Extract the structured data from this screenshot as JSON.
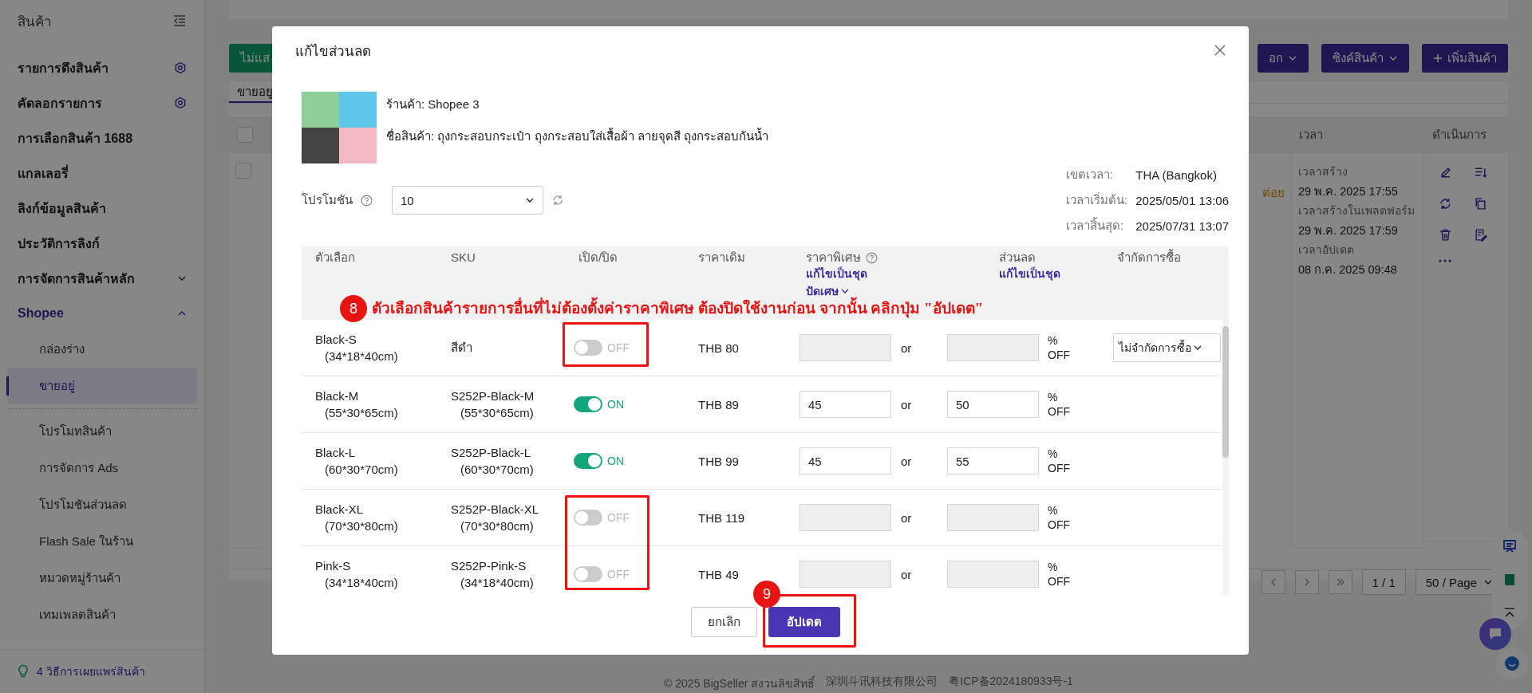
{
  "sidebar": {
    "title": "สินค้า",
    "items": [
      {
        "label": "รายการดึงสินค้า",
        "kind": "setting",
        "selected": false
      },
      {
        "label": "คัดลอกรายการ",
        "kind": "setting",
        "selected": false
      },
      {
        "label": "การเลือกสินค้า 1688",
        "kind": "plain",
        "selected": false
      },
      {
        "label": "แกลเลอรี่",
        "kind": "plain",
        "selected": false
      },
      {
        "label": "ลิงก์ข้อมูลสินค้า",
        "kind": "plain",
        "selected": false
      },
      {
        "label": "ประวัติการลิงก์",
        "kind": "plain",
        "selected": false
      },
      {
        "label": "การจัดการสินค้าหลัก",
        "kind": "group",
        "expanded": false,
        "selected": false
      },
      {
        "label": "Shopee",
        "kind": "group",
        "expanded": true,
        "selected": true,
        "sections": [
          {
            "items": [
              {
                "label": "กล่องร่าง",
                "selected": false
              },
              {
                "label": "ขายอยู่",
                "selected": true
              }
            ]
          },
          {
            "items": [
              {
                "label": "โปรโมทสินค้า",
                "selected": false
              },
              {
                "label": "การจัดการ Ads",
                "selected": false
              },
              {
                "label": "โปรโมชันส่วนลด",
                "selected": false
              },
              {
                "label": "Flash Sale ในร้าน",
                "selected": false
              },
              {
                "label": "หมวดหมู่ร้านค้า",
                "selected": false
              },
              {
                "label": "เทมเพลตสินค้า",
                "selected": false
              }
            ]
          }
        ]
      }
    ],
    "tip": "4 วิธีการเผยแพร่สินค้า"
  },
  "toolbar": {
    "left_button": "ไม่แส",
    "right_buttons": [
      {
        "label": "อก",
        "kind": "dropdown"
      },
      {
        "label": "ซิงค์สินค้า",
        "kind": "dropdown"
      },
      {
        "label": "เพิ่มสินค้า",
        "kind": "add"
      }
    ]
  },
  "tabs": [
    {
      "label": "ขายอยู",
      "selected": true
    }
  ],
  "table": {
    "select_all_checked": false,
    "columns": [
      "เวลา",
      "ดำเนินการ"
    ],
    "rows": [
      {
        "checked": false,
        "status_fragment": "ต่อย",
        "times": [
          {
            "label": "เวลาสร้าง",
            "value": "29 พ.ค. 2025 17:55"
          },
          {
            "label": "เวลาสร้างในเพลตฟอร์ม",
            "value": "29 พ.ค. 2025 17:59"
          },
          {
            "label": "เวลาอัปเดต",
            "value": "08 ก.ค. 2025 09:48"
          }
        ]
      }
    ]
  },
  "pagination": {
    "page": "1 / 1",
    "page_size": "50 / Page"
  },
  "footer": [
    "© 2025 BigSeller สงวนลิขสิทธิ์",
    "深圳斗讯科技有限公司",
    "粤ICP备2024180933号-1"
  ],
  "dialog": {
    "title": "แก้ไขส่วนลด",
    "store_label": "ร้านค้า:",
    "store": "Shopee 3",
    "product_label": "ชื่อสินค้า:",
    "product": "ถุงกระสอบกระเป๋า ถุงกระสอบใส่เสื้อผ้า ลายจุดสี ถุงกระสอบกันน้ำ",
    "promotion_label": "โปรโมชัน",
    "promotion_value": "10",
    "time_info": [
      {
        "label": "เขตเวลา:",
        "value": "THA (Bangkok)"
      },
      {
        "label": "เวลาเริ่มต้น:",
        "value": "2025/05/01 13:06"
      },
      {
        "label": "เวลาสิ้นสุด:",
        "value": "2025/07/31 13:07"
      }
    ],
    "columns": [
      {
        "label": "ตัวเลือก"
      },
      {
        "label": "SKU"
      },
      {
        "label": "เปิด/ปิด"
      },
      {
        "label": "ราคาเดิม"
      },
      {
        "label": "ราคาพิเศษ",
        "help": true,
        "links": [
          {
            "label": "แก้ไขเป็นชุด",
            "dropdown": false
          },
          {
            "label": "ปัดเศษ",
            "dropdown": true
          }
        ]
      },
      {
        "label": "ส่วนลด",
        "links": [
          {
            "label": "แก้ไขเป็นชุด",
            "dropdown": false
          }
        ]
      },
      {
        "label": "จำกัดการซื้อ"
      }
    ],
    "rows": [
      {
        "option": "Black-S",
        "option_size": "(34*18*40cm)",
        "sku": "สีดำ",
        "on": false,
        "toggle_label": "OFF",
        "price": "THB 80",
        "or": "or",
        "percent": "%",
        "off": "OFF",
        "limit": "ไม่จำกัดการซื้อ"
      },
      {
        "option": "Black-M",
        "option_size": "(55*30*65cm)",
        "sku": "S252P-Black-M",
        "sku_size": "(55*30*65cm)",
        "on": true,
        "toggle_label": "ON",
        "price": "THB 89",
        "special_price": "45",
        "discount": "50",
        "or": "or",
        "percent": "%",
        "off": "OFF"
      },
      {
        "option": "Black-L",
        "option_size": "(60*30*70cm)",
        "sku": "S252P-Black-L",
        "sku_size": "(60*30*70cm)",
        "on": true,
        "toggle_label": "ON",
        "price": "THB 99",
        "special_price": "45",
        "discount": "55",
        "or": "or",
        "percent": "%",
        "off": "OFF"
      },
      {
        "option": "Black-XL",
        "option_size": "(70*30*80cm)",
        "sku": "S252P-Black-XL",
        "sku_size": "(70*30*80cm)",
        "on": false,
        "toggle_label": "OFF",
        "price": "THB 119",
        "or": "or",
        "percent": "%",
        "off": "OFF"
      },
      {
        "option": "Pink-S",
        "option_size": "(34*18*40cm)",
        "sku": "S252P-Pink-S",
        "sku_size": "(34*18*40cm)",
        "on": false,
        "toggle_label": "OFF",
        "price": "THB 49",
        "or": "or",
        "percent": "%",
        "off": "OFF"
      }
    ],
    "buttons": [
      {
        "label": "ยกเลิก",
        "kind": "cancel"
      },
      {
        "label": "อัปเดต",
        "kind": "primary"
      }
    ],
    "annotations": [
      {
        "number": "8",
        "text": "ตัวเลือกสินค้ารายการอื่นที่ไม่ต้องตั้งค่าราคาพิเศษ ต้องปิดใช้งานก่อน จากนั้น คลิกปุ่ม \"อัปเดต\""
      },
      {
        "number": "9"
      }
    ]
  }
}
